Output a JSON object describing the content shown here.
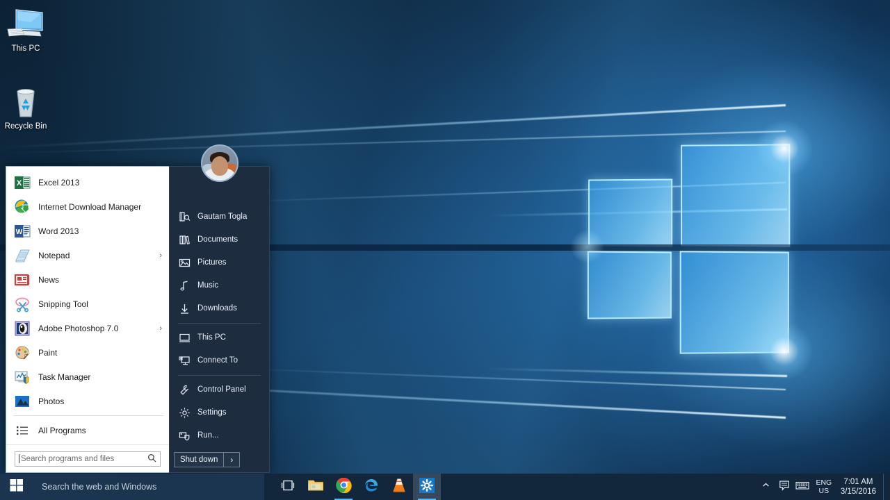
{
  "desktop": {
    "icons": [
      {
        "label": "This PC",
        "icon": "this-pc-icon"
      },
      {
        "label": "Recycle Bin",
        "icon": "recycle-bin-icon"
      }
    ]
  },
  "start_menu": {
    "left_panel": {
      "programs": [
        {
          "label": "Excel 2013",
          "icon": "excel-icon",
          "has_submenu": false,
          "arrow": ""
        },
        {
          "label": "Internet Download Manager",
          "icon": "idm-icon",
          "has_submenu": false,
          "arrow": ""
        },
        {
          "label": "Word 2013",
          "icon": "word-icon",
          "has_submenu": false,
          "arrow": ""
        },
        {
          "label": "Notepad",
          "icon": "notepad-icon",
          "has_submenu": true,
          "arrow": "›"
        },
        {
          "label": "News",
          "icon": "news-icon",
          "has_submenu": false,
          "arrow": ""
        },
        {
          "label": "Snipping Tool",
          "icon": "snipping-tool-icon",
          "has_submenu": false,
          "arrow": ""
        },
        {
          "label": "Adobe Photoshop 7.0",
          "icon": "photoshop-icon",
          "has_submenu": true,
          "arrow": "›"
        },
        {
          "label": "Paint",
          "icon": "paint-icon",
          "has_submenu": false,
          "arrow": ""
        },
        {
          "label": "Task Manager",
          "icon": "task-manager-icon",
          "has_submenu": false,
          "arrow": ""
        },
        {
          "label": "Photos",
          "icon": "photos-icon",
          "has_submenu": false,
          "arrow": ""
        }
      ],
      "all_programs": {
        "label": "All Programs",
        "icon": "all-programs-icon"
      },
      "search": {
        "placeholder": "Search programs and files",
        "value": "",
        "icon": "magnifier-icon"
      }
    },
    "right_panel": {
      "user": {
        "name": "Gautam Togla",
        "avatar": "user-avatar"
      },
      "items": [
        {
          "label": "Gautam Togla",
          "icon": "user-folder-icon"
        },
        {
          "label": "Documents",
          "icon": "documents-icon"
        },
        {
          "label": "Pictures",
          "icon": "pictures-icon"
        },
        {
          "label": "Music",
          "icon": "music-icon"
        },
        {
          "label": "Downloads",
          "icon": "downloads-icon"
        },
        {
          "label": "This PC",
          "icon": "this-pc-icon"
        },
        {
          "label": "Connect To",
          "icon": "connect-to-icon"
        },
        {
          "label": "Control Panel",
          "icon": "control-panel-icon"
        },
        {
          "label": "Settings",
          "icon": "settings-gear-icon"
        },
        {
          "label": "Run...",
          "icon": "run-icon"
        }
      ],
      "separator_after_index": [
        4,
        6
      ],
      "shutdown": {
        "label": "Shut down",
        "arrow": "›"
      }
    }
  },
  "taskbar": {
    "start_button": {
      "icon": "windows-logo-icon"
    },
    "search": {
      "placeholder": "Search the web and Windows",
      "value": ""
    },
    "pinned": [
      {
        "name": "Task View",
        "icon": "task-view-icon",
        "running": false,
        "active": false
      },
      {
        "name": "File Explorer",
        "icon": "file-explorer-icon",
        "running": false,
        "active": false
      },
      {
        "name": "Google Chrome",
        "icon": "chrome-icon",
        "running": true,
        "active": false
      },
      {
        "name": "Microsoft Edge",
        "icon": "edge-icon",
        "running": false,
        "active": false
      },
      {
        "name": "VLC media player",
        "icon": "vlc-icon",
        "running": false,
        "active": false
      },
      {
        "name": "Settings",
        "icon": "settings-gear-icon",
        "running": true,
        "active": true
      }
    ],
    "tray": {
      "show_hidden": {
        "icon": "chevron-up-icon"
      },
      "action_center": {
        "icon": "action-center-icon"
      },
      "keyboard": {
        "icon": "keyboard-icon"
      },
      "language": {
        "line1": "ENG",
        "line2": "US"
      },
      "clock": {
        "time": "7:01 AM",
        "date": "3/15/2016"
      }
    }
  },
  "colors": {
    "taskbar_bg": "#12263c",
    "start_left_bg": "#ffffff",
    "start_right_bg": "#1e2c40",
    "accent": "#0078d7",
    "text_light": "#eaf0f7",
    "text_dark": "#1b1b1b"
  }
}
